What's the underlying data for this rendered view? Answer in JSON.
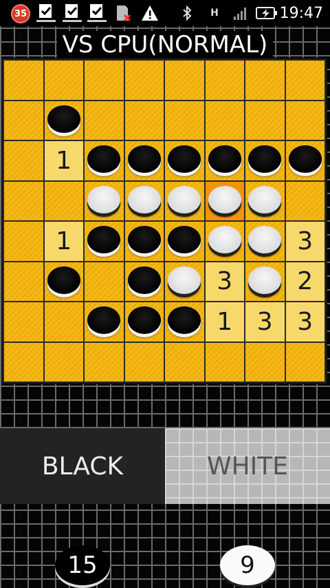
{
  "status_bar": {
    "notification_count": "35",
    "time": "19:47",
    "icons": [
      "notification-badge",
      "task-check-icon",
      "task-check-icon",
      "task-check-icon",
      "sd-card-error-icon",
      "warning-icon",
      "bluetooth-icon",
      "hsdpa-icon",
      "signal-icon",
      "battery-charging-icon"
    ]
  },
  "title": "VS CPU(NORMAL)",
  "board": {
    "rows": [
      [
        "",
        "",
        "",
        "",
        "",
        "",
        "",
        ""
      ],
      [
        "",
        "B",
        "",
        "",
        "",
        "",
        "",
        ""
      ],
      [
        "",
        "1",
        "B",
        "B",
        "B",
        "B",
        "B",
        "B"
      ],
      [
        "",
        "",
        "W",
        "W",
        "W",
        "W*",
        "W",
        ""
      ],
      [
        "",
        "1",
        "B",
        "B",
        "B",
        "W",
        "W",
        "3"
      ],
      [
        "",
        "B",
        "",
        "B",
        "W",
        "3",
        "W",
        "2"
      ],
      [
        "",
        "",
        "B",
        "B",
        "B",
        "1",
        "3",
        "3"
      ],
      [
        "",
        "",
        "",
        "",
        "",
        "",
        "",
        ""
      ]
    ],
    "legend": {
      "B": "black disc",
      "W": "white disc",
      "W*": "last move (white)",
      "number": "possible move flip count"
    }
  },
  "players": {
    "black_label": "BLACK",
    "white_label": "WHITE",
    "active": "black"
  },
  "scores": {
    "black": "15",
    "white": "9"
  },
  "colors": {
    "board_cell": "#f5b50c",
    "hint_cell": "#f7d86a",
    "last_move_cell": "#f3930c"
  }
}
